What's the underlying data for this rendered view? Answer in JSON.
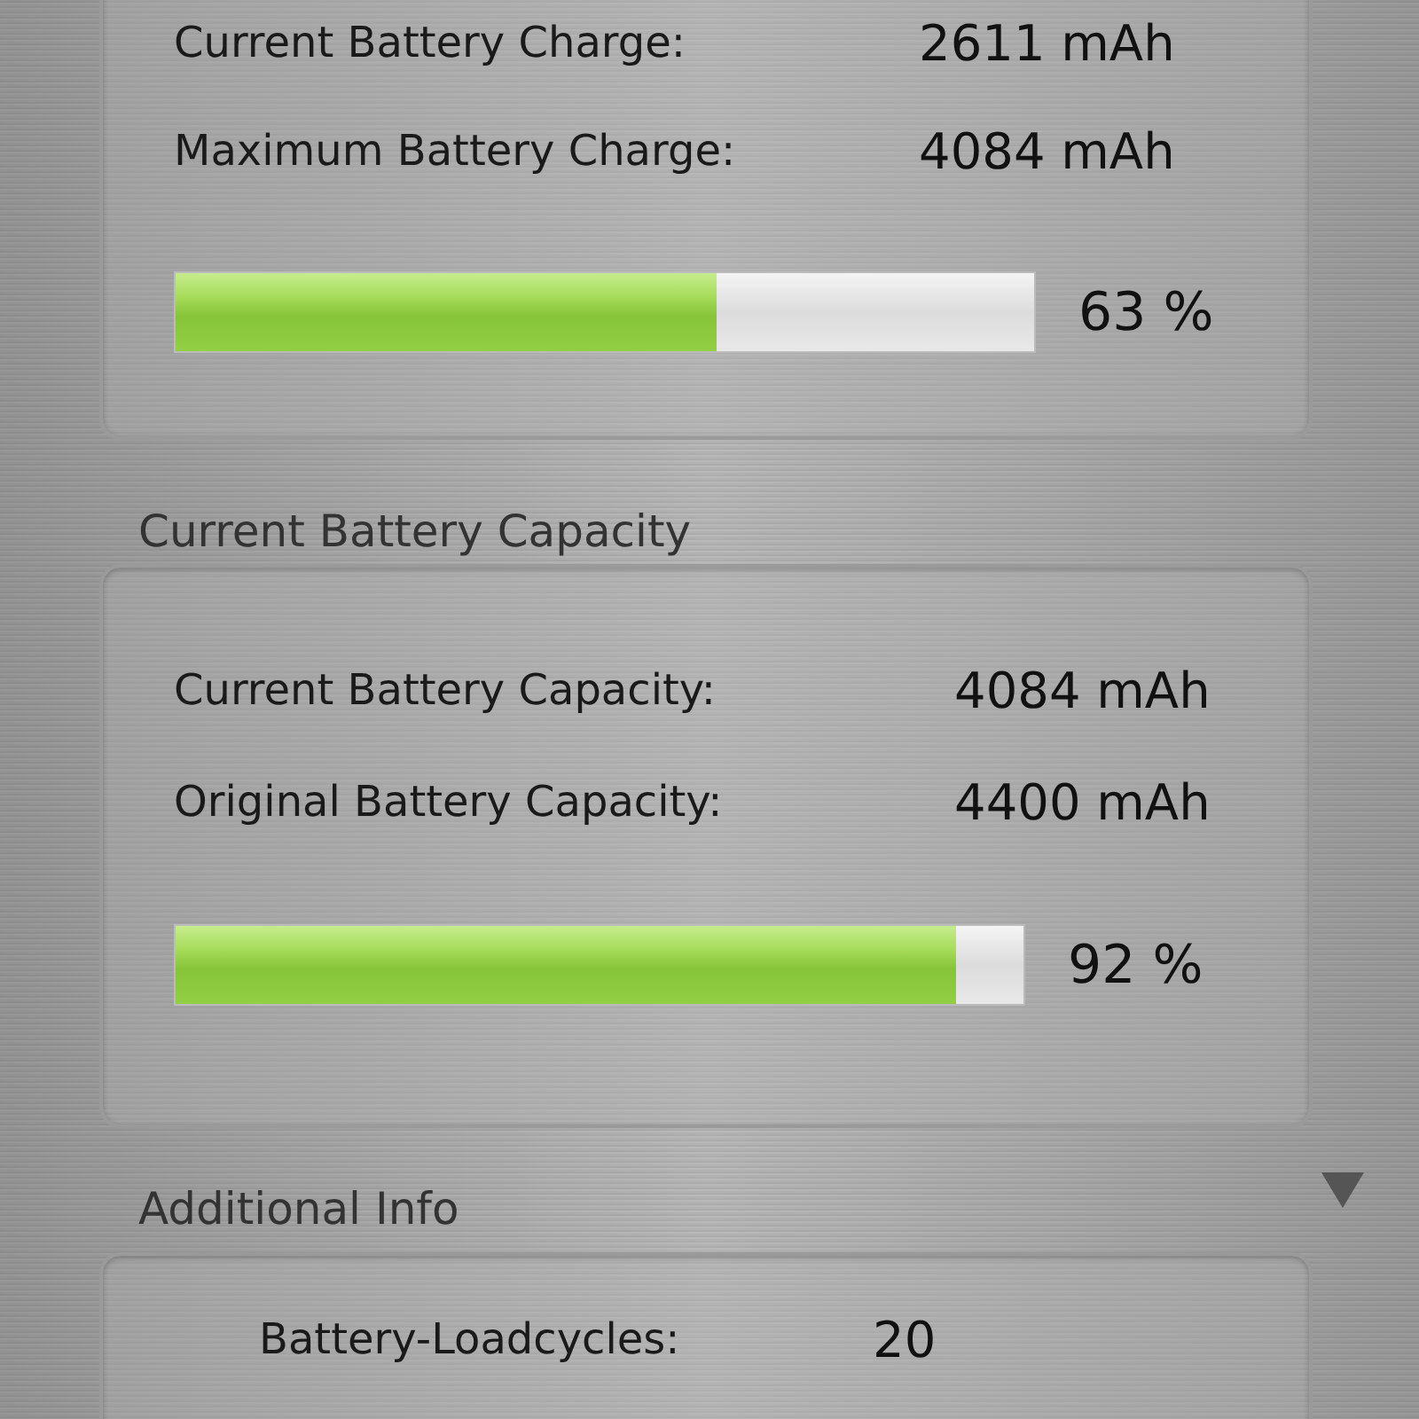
{
  "charge_panel": {
    "rows": [
      {
        "label": "Current Battery Charge:",
        "value": "2611 mAh"
      },
      {
        "label": "Maximum Battery Charge:",
        "value": "4084 mAh"
      }
    ],
    "meter": {
      "level": 0.63,
      "reading": "63 %"
    }
  },
  "capacity_section": {
    "title": "Current Battery Capacity",
    "rows": [
      {
        "label": "Current Battery Capacity:",
        "value": "4084 mAh"
      },
      {
        "label": "Original Battery Capacity:",
        "value": "4400 mAh"
      }
    ],
    "meter": {
      "level": 0.92,
      "reading": "92 %"
    }
  },
  "additional_section": {
    "title": "Additional Info",
    "expanded": true,
    "rows": [
      {
        "label": "Battery-Loadcycles:",
        "value": "20"
      }
    ]
  }
}
